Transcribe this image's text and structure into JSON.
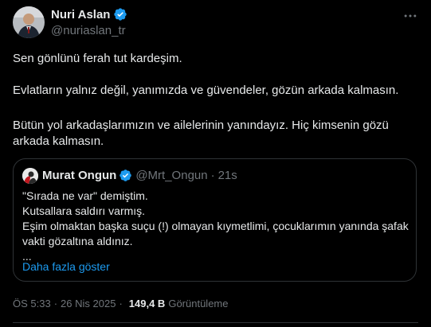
{
  "author": {
    "display_name": "Nuri Aslan",
    "handle": "@nuriaslan_tr",
    "verified": true,
    "verified_color": "#1d9bf0"
  },
  "tweet": {
    "paragraphs": [
      "Sen gönlünü ferah tut kardeşim.",
      "Evlatların yalnız değil, yanımızda ve güvendeler, gözün arkada kalmasın.",
      "Bütün yol arkadaşlarımızın ve ailelerinin yanındayız. Hiç kimsenin gözü arkada kalmasın."
    ]
  },
  "quote": {
    "display_name": "Murat Ongun",
    "handle": "@Mrt_Ongun",
    "separator": "·",
    "time": "21s",
    "lines": [
      "\"Sırada ne var\" demiştim.",
      "Kutsallara saldırı varmış.",
      "Eşim olmaktan başka suçu (!) olmayan kıymetlimi, çocuklarımın yanında şafak",
      "vakti gözaltına aldınız.",
      "..."
    ],
    "show_more": "Daha fazla göster"
  },
  "meta": {
    "time": "ÖS 5:33",
    "separator": "·",
    "date": "26 Nis 2025",
    "views": "149,4 B",
    "views_label": "Görüntüleme"
  },
  "icons": {
    "more": "more-horizontal-icon",
    "verified": "verified-badge-icon"
  },
  "colors": {
    "background": "#000000",
    "text": "#e7e9ea",
    "muted": "#71767b",
    "accent": "#1d9bf0",
    "border": "#2f3336"
  }
}
